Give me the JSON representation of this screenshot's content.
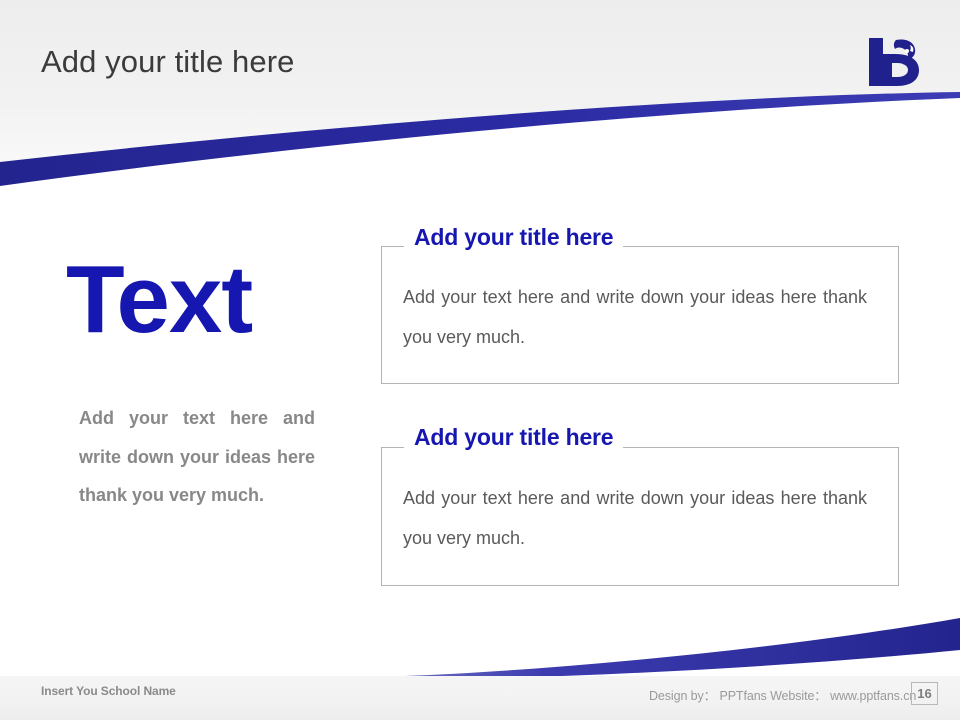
{
  "slide": {
    "title": "Add your title here",
    "accent_color": "#1616b0",
    "swoosh_color": "#2b2b9c",
    "body_gray": "#5a5a5a",
    "left_text_gray": "#888888"
  },
  "logo": {
    "name": "university-logo",
    "alt": "Stylized letter b with face"
  },
  "left": {
    "headline": "Text",
    "paragraph": "Add your text here and write down your ideas here thank you very much."
  },
  "boxes": [
    {
      "title": "Add your title here",
      "paragraph": "Add your text here and write down your ideas here thank you very much."
    },
    {
      "title": "Add your title here",
      "paragraph": "Add your text here and write down your ideas here thank you very much."
    }
  ],
  "footer": {
    "school_name": "Insert You School Name",
    "credit": "Design by： PPTfans  Website： www.pptfans.cn",
    "page_number": "16"
  }
}
